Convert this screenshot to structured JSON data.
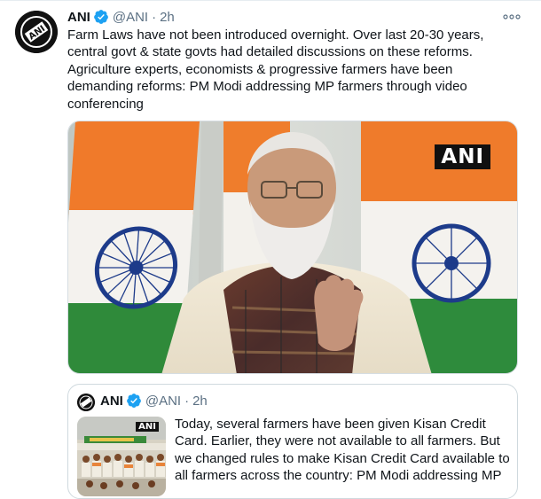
{
  "tweet": {
    "author_name": "ANI",
    "handle": "@ANI",
    "separator": "·",
    "time": "2h",
    "verified": true,
    "avatar_logo": "ANI",
    "text": "Farm Laws have not been introduced overnight. Over last 20-30 years, central govt & state govts had detailed discussions on these reforms. Agriculture experts, economists & progressive farmers have been demanding reforms: PM Modi addressing MP farmers through video conferencing",
    "media": {
      "watermark": "ANI"
    },
    "more_icon": "more-dots-icon"
  },
  "quoted_tweet": {
    "author_name": "ANI",
    "handle": "@ANI",
    "separator": "·",
    "time": "2h",
    "verified": true,
    "text": "Today, several farmers have been given Kisan Credit Card. Earlier, they were not available to all farmers. But we changed rules to make Kisan Credit Card available to all farmers across the country: PM Modi addressing MP",
    "thumbnail_watermark": "ANI"
  },
  "colors": {
    "verified_blue": "#1da1f2",
    "secondary_text": "#5b7083",
    "border": "#cfd9de"
  }
}
